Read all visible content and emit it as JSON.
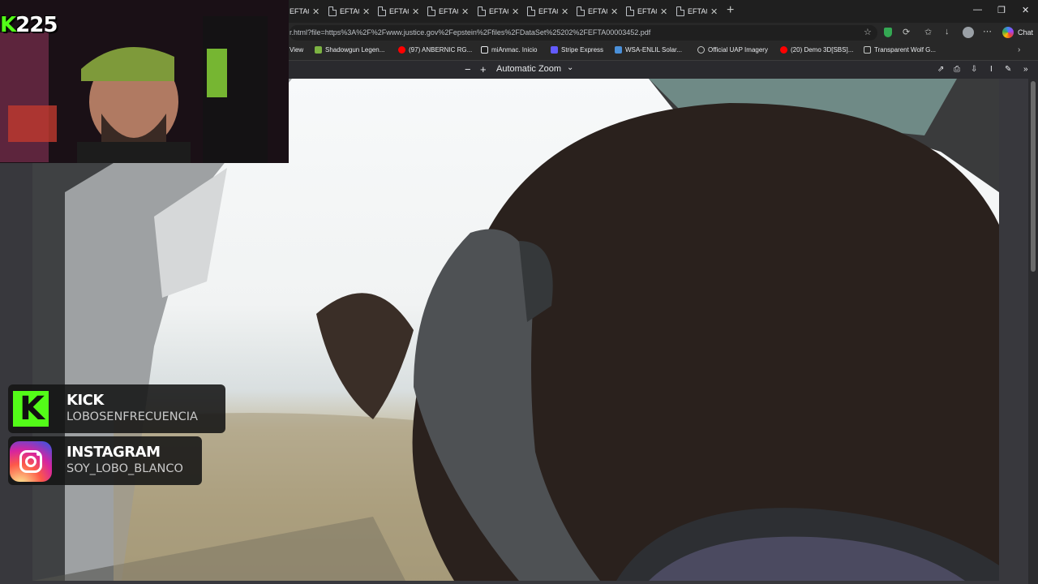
{
  "browser": {
    "tabs": [
      {
        "label": "EFTA0"
      },
      {
        "label": "EFTA0"
      },
      {
        "label": "EFTA0"
      },
      {
        "label": "EFTA0"
      },
      {
        "label": "EFTA0"
      },
      {
        "label": "EFTA0"
      },
      {
        "label": "EFTA0"
      },
      {
        "label": "EFTA0"
      },
      {
        "label": "EFTA0"
      }
    ],
    "address": "r.html?file=https%3A%2F%2Fwww.justice.gov%2Fepstein%2Ffiles%2FDataSet%25202%2FEFTA00003452.pdf",
    "chat_label": "Chat",
    "bookmarks": [
      {
        "label": "View"
      },
      {
        "label": "Shadowgun Legen..."
      },
      {
        "label": "(97) ANBERNIC RG..."
      },
      {
        "label": "miAnmac. Inicio"
      },
      {
        "label": "Stripe Express"
      },
      {
        "label": "WSA-ENLIL Solar..."
      },
      {
        "label": "Official UAP Imagery"
      },
      {
        "label": "(20) Demo 3D[SBS]..."
      },
      {
        "label": "Transparent Wolf G..."
      }
    ]
  },
  "pdf_viewer": {
    "zoom_label": "Automatic Zoom"
  },
  "stream_overlay": {
    "counter": "225",
    "kick": {
      "name": "KICK",
      "handle": "LOBOSENFRECUENCIA"
    },
    "instagram": {
      "name": "INSTAGRAM",
      "handle": "SOY_LOBO_BLANCO"
    }
  },
  "colors": {
    "kick_green": "#53fc18",
    "browser_bg": "#1f1f1f",
    "viewer_bg": "#38383d"
  }
}
